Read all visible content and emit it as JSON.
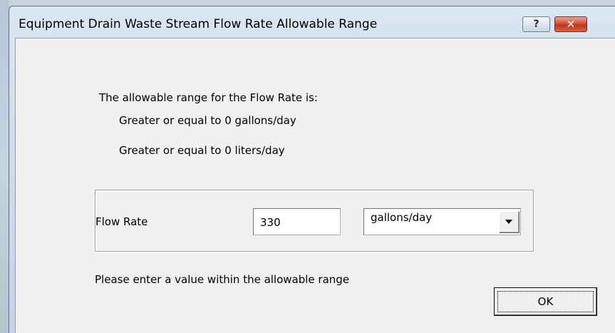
{
  "window": {
    "title": "Equipment Drain Waste Stream Flow Rate Allowable Range",
    "help_label": "?",
    "close_label": "✕"
  },
  "info": {
    "intro": "The allowable range for the Flow Rate is:",
    "line1": "Greater or equal to 0 gallons/day",
    "line2": "Greater or equal to 0 liters/day"
  },
  "flow": {
    "label": "Flow Rate",
    "value": "330",
    "unit_selected": "gallons/day"
  },
  "message": "Please enter a value within the allowable range",
  "ok_label": "OK"
}
